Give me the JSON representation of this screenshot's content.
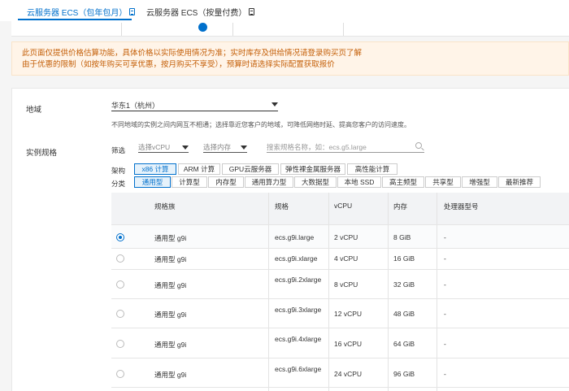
{
  "top_tabs": [
    {
      "label": "云服务器 ECS（包年包月）",
      "active": true
    },
    {
      "label": "云服务器 ECS（按量付费）",
      "active": false
    }
  ],
  "notice": {
    "line1": "此页面仅提供价格估算功能，具体价格以实际使用情况为准；实时库存及供给情况请登录购买页了解",
    "line2": "由于优惠的限制（如按年购买可享优惠，按月购买不享受），预算时请选择实际配置获取报价"
  },
  "region": {
    "label": "地域",
    "selected": "华东1（杭州）",
    "hint": "不同地域的实例之间内网互不相通；选择靠近您客户的地域，可降低网络时延、提高您客户的访问速度。"
  },
  "spec": {
    "label": "实例规格",
    "filter_label": "筛选",
    "vcpu_placeholder": "选择vCPU",
    "mem_placeholder": "选择内存",
    "search_placeholder": "搜索规格名称，如：ecs.g5.large",
    "arch_label": "架构",
    "arch_options": [
      "x86 计算",
      "ARM 计算",
      "GPU云服务器",
      "弹性裸金属服务器",
      "高性能计算"
    ],
    "category_label": "分类",
    "category_options": [
      "通用型",
      "计算型",
      "内存型",
      "通用算力型",
      "大数据型",
      "本地 SSD",
      "高主频型",
      "共享型",
      "增强型",
      "最新推荐"
    ]
  },
  "table": {
    "columns": [
      "规格族",
      "规格",
      "vCPU",
      "内存",
      "处理器型号"
    ],
    "rows": [
      {
        "family": "通用型 g9i",
        "spec": "ecs.g9i.large",
        "vcpu": "2 vCPU",
        "mem": "8 GiB",
        "cpu": "-",
        "selected": true
      },
      {
        "family": "通用型 g9i",
        "spec": "ecs.g9i.xlarge",
        "vcpu": "4 vCPU",
        "mem": "16 GiB",
        "cpu": "-",
        "selected": false
      },
      {
        "family": "通用型 g9i",
        "spec": "ecs.g9i.2xlarge",
        "vcpu": "8 vCPU",
        "mem": "32 GiB",
        "cpu": "-",
        "selected": false
      },
      {
        "family": "通用型 g9i",
        "spec": "ecs.g9i.3xlarge",
        "vcpu": "12 vCPU",
        "mem": "48 GiB",
        "cpu": "-",
        "selected": false
      },
      {
        "family": "通用型 g9i",
        "spec": "ecs.g9i.4xlarge",
        "vcpu": "16 vCPU",
        "mem": "64 GiB",
        "cpu": "-",
        "selected": false
      },
      {
        "family": "通用型 g9i",
        "spec": "ecs.g9i.6xlarge",
        "vcpu": "24 vCPU",
        "mem": "96 GiB",
        "cpu": "-",
        "selected": false
      }
    ]
  },
  "colors": {
    "accent": "#0070cc",
    "notice_text": "#c45f08",
    "notice_bg": "#fff4e8"
  }
}
